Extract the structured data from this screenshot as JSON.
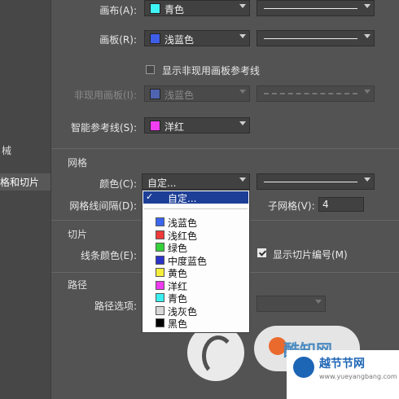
{
  "sidebar": {
    "items": [
      {
        "label": "械"
      },
      {
        "label": "格和切片"
      }
    ]
  },
  "guides": {
    "canvas": {
      "label": "画布(A):",
      "color_name": "青色",
      "swatch": "#3ff4f4"
    },
    "artboard": {
      "label": "画板(R):",
      "color_name": "浅蓝色",
      "swatch": "#3f5ee8"
    },
    "show_inactive_label": "显示非现用画板参考线",
    "inactive_artboard": {
      "label": "非现用画板(I):",
      "color_name": "浅蓝色",
      "swatch": "#4e64b0"
    },
    "smart_guides": {
      "label": "智能参考线(S):",
      "color_name": "洋红",
      "swatch": "#f23ef2"
    }
  },
  "grid": {
    "title": "网格",
    "color_label": "颜色(C):",
    "color_value": "自定...",
    "spacing_label": "网格线间隔(D):",
    "subdivisions_label": "子网格(V):",
    "subdivisions_value": "4"
  },
  "slices": {
    "title": "切片",
    "line_color_label": "线条颜色(E):",
    "show_numbers_label": "显示切片编号(M)"
  },
  "path": {
    "title": "路径",
    "options_label": "路径选项:"
  },
  "dropdown": {
    "highlighted": "自定...",
    "items": [
      {
        "label": "浅蓝色",
        "color": "#3a66f0"
      },
      {
        "label": "浅红色",
        "color": "#ef3a3a"
      },
      {
        "label": "绿色",
        "color": "#35d23a"
      },
      {
        "label": "中度蓝色",
        "color": "#2c33c8"
      },
      {
        "label": "黄色",
        "color": "#f5ef3a"
      },
      {
        "label": "洋红",
        "color": "#ef3aef"
      },
      {
        "label": "青色",
        "color": "#3aeff0"
      },
      {
        "label": "浅灰色",
        "color": "#d8d8d8"
      },
      {
        "label": "黑色",
        "color": "#000000"
      }
    ]
  },
  "watermark": {
    "brand": "酷知网",
    "corner_title": "越节节网",
    "corner_url": "www.yueyangbang.com"
  }
}
